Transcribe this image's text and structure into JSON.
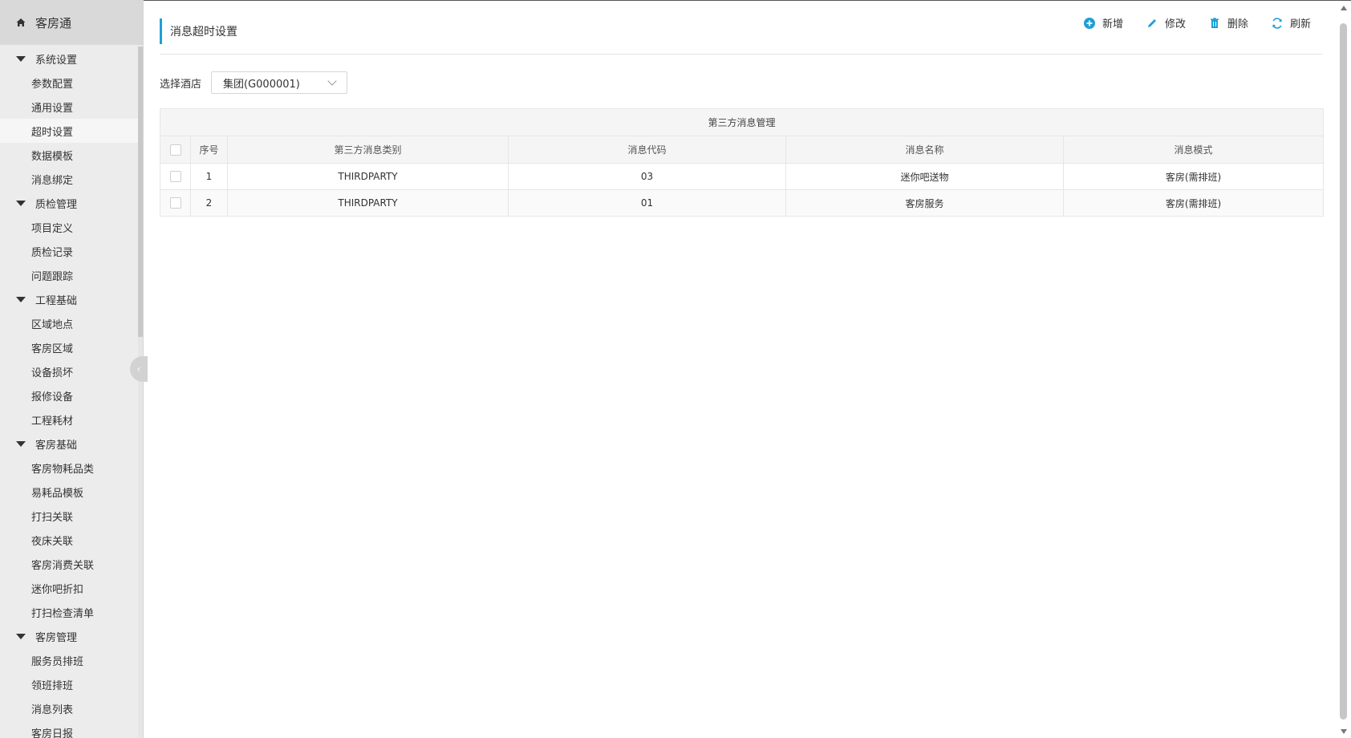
{
  "app": {
    "title": "客房通"
  },
  "sidebar": {
    "groups": [
      {
        "title": "系统设置",
        "items": [
          "参数配置",
          "通用设置",
          "超时设置",
          "数据模板",
          "消息绑定"
        ]
      },
      {
        "title": "质检管理",
        "items": [
          "项目定义",
          "质检记录",
          "问题跟踪"
        ]
      },
      {
        "title": "工程基础",
        "items": [
          "区域地点",
          "客房区域",
          "设备损坏",
          "报修设备",
          "工程耗材"
        ]
      },
      {
        "title": "客房基础",
        "items": [
          "客房物耗品类",
          "易耗品模板",
          "打扫关联",
          "夜床关联",
          "客房消费关联",
          "迷你吧折扣",
          "打扫检查清单"
        ]
      },
      {
        "title": "客房管理",
        "items": [
          "服务员排班",
          "领班排班",
          "消息列表",
          "客房日报"
        ]
      }
    ],
    "active_item": "超时设置"
  },
  "page": {
    "title": "消息超时设置",
    "toolbar": {
      "add": "新增",
      "edit": "修改",
      "delete": "删除",
      "refresh": "刷新"
    },
    "filter": {
      "label": "选择酒店",
      "value": "集团(G000001)"
    }
  },
  "table": {
    "caption": "第三方消息管理",
    "headers": [
      "序号",
      "第三方消息类别",
      "消息代码",
      "消息名称",
      "消息模式"
    ],
    "rows": [
      [
        "1",
        "THIRDPARTY",
        "03",
        "迷你吧送物",
        "客房(需排班)"
      ],
      [
        "2",
        "THIRDPARTY",
        "01",
        "客房服务",
        "客房(需排班)"
      ]
    ]
  },
  "colors": {
    "accent": "#1e9fd6",
    "sidebar_bg": "#ececec",
    "brand_bg": "#d9d9d9"
  }
}
